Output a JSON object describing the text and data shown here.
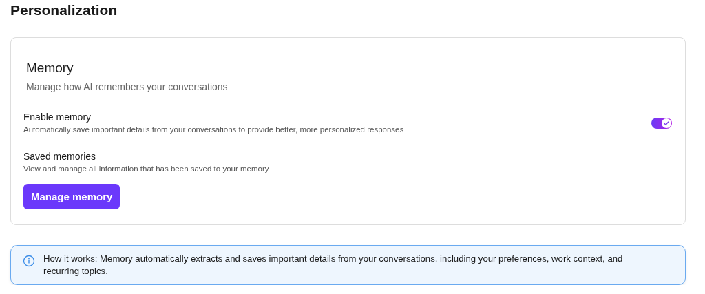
{
  "page_title": "Personalization",
  "card": {
    "title": "Memory",
    "subtitle": "Manage how AI remembers your conversations",
    "settings": [
      {
        "kind": "toggle",
        "label": "Enable memory",
        "description": "Automatically save important details from your conversations to provide better, more personalized responses",
        "on": true
      },
      {
        "kind": "action",
        "label": "Saved memories",
        "description": "View and manage all information that has been saved to your memory",
        "button": "Manage memory"
      }
    ]
  },
  "info": {
    "text": "How it works: Memory automatically extracts and saves important details from your conversations, including your preferences, work context, and recurring topics."
  }
}
